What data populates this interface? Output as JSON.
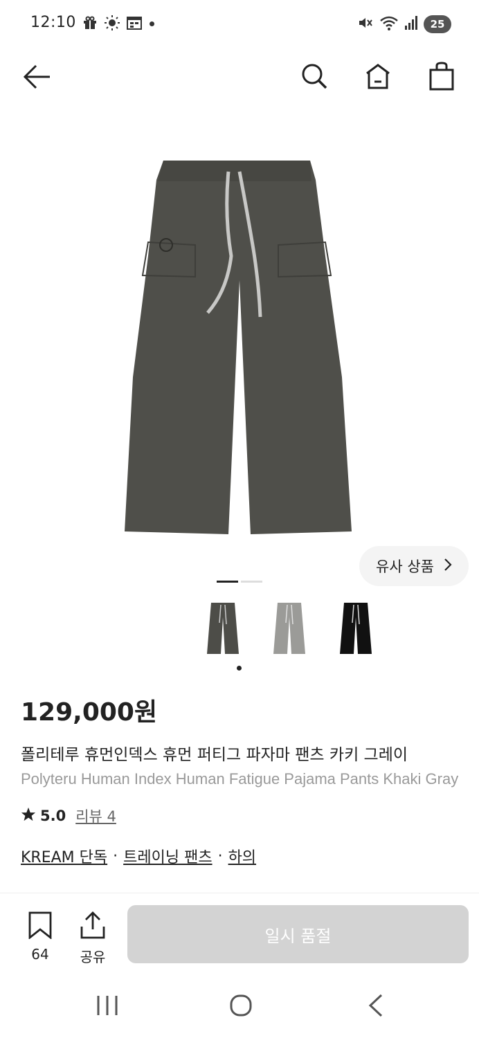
{
  "status_bar": {
    "time": "12:10",
    "left_icons": [
      "gift-icon",
      "brightness-icon",
      "calendar-icon"
    ],
    "right_icons": [
      "mute-icon",
      "wifi-icon",
      "signal-icon"
    ],
    "battery": "25"
  },
  "header": {
    "back_icon": "arrow-left-icon",
    "search_icon": "search-icon",
    "home_icon": "home-icon",
    "cart_icon": "shopping-bag-icon"
  },
  "product": {
    "image_color": "#4f4f4a",
    "similar_label": "유사 상품",
    "pager": {
      "pages": 2,
      "current": 1
    },
    "thumbnails": [
      {
        "color": "#4d4d48",
        "selected": true
      },
      {
        "color": "#9b9b98",
        "selected": false
      },
      {
        "color": "#111111",
        "selected": false
      }
    ],
    "price": "129,000원",
    "name_ko": "폴리테루 휴먼인덱스 휴먼 퍼티그 파자마 팬츠 카키 그레이",
    "name_en": "Polyteru Human Index Human Fatigue Pajama Pants Khaki Gray",
    "rating": "5.0",
    "review_label": "리뷰 4",
    "tags": [
      "KREAM 단독",
      "트레이닝 팬츠",
      "하의"
    ]
  },
  "bottom_bar": {
    "bookmark_count": "64",
    "share_label": "공유",
    "soldout_label": "일시 품절"
  },
  "system_nav": {
    "icons": [
      "recent-apps-icon",
      "home-circle-icon",
      "back-chevron-icon"
    ]
  }
}
